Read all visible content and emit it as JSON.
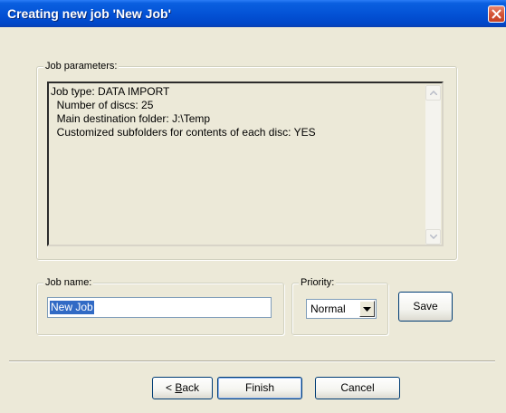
{
  "window": {
    "title": "Creating new job 'New Job'"
  },
  "job_parameters": {
    "legend": "Job parameters:",
    "lines": [
      "Job type: DATA IMPORT",
      "  Number of discs: 25",
      "  Main destination folder: J:\\Temp",
      "  Customized subfolders for contents of each disc: YES"
    ]
  },
  "job_name": {
    "legend": "Job name:",
    "value": "New Job"
  },
  "priority": {
    "legend": "Priority:",
    "value": "Normal"
  },
  "buttons": {
    "save": "Save",
    "back_symbol": "< ",
    "back_mnemonic": "B",
    "back_rest": "ack",
    "finish": "Finish",
    "cancel": "Cancel"
  },
  "icons": {
    "close": "close-icon",
    "scroll_up": "chevron-up-icon",
    "scroll_down": "chevron-down-icon",
    "dropdown": "chevron-down-icon"
  },
  "colors": {
    "titlebar": "#0453d6",
    "dialog_bg": "#ece9d8",
    "selection": "#316ac5",
    "close": "#d45537"
  }
}
